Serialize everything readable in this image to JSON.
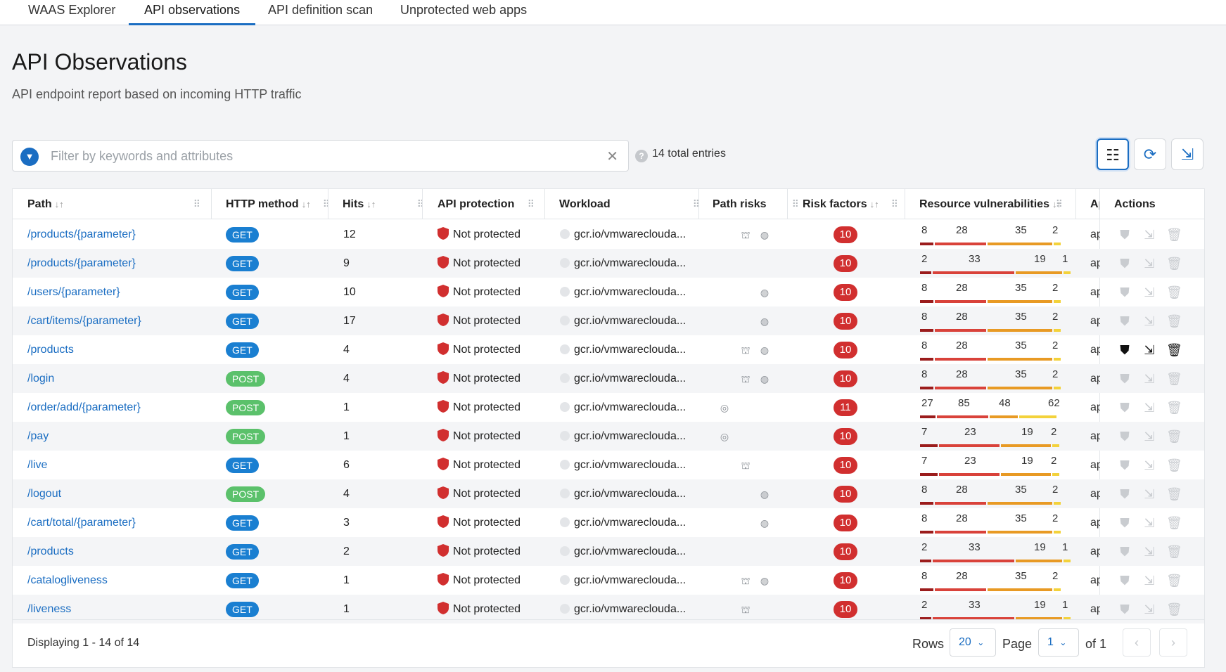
{
  "tabs": [
    "WAAS Explorer",
    "API observations",
    "API definition scan",
    "Unprotected web apps"
  ],
  "page": {
    "title": "API Observations",
    "subtitle": "API endpoint report based on incoming HTTP traffic"
  },
  "filter": {
    "placeholder": "Filter by keywords and attributes",
    "total": "14 total entries"
  },
  "columns": {
    "path": "Path",
    "method": "HTTP method",
    "hits": "Hits",
    "protection": "API protection",
    "workload": "Workload",
    "path_risks": "Path risks",
    "risk_factors": "Risk factors",
    "vulns": "Resource vulnerabilities",
    "app": "Ap",
    "actions": "Actions"
  },
  "rows": [
    {
      "path": "/products/{parameter}",
      "method": "GET",
      "hits": "12",
      "protection": "Not protected",
      "workload": "gcr.io/vmwareclouda...",
      "risks": [
        "door",
        "globe"
      ],
      "risk": "10",
      "vulns": [
        "8",
        "28",
        "35",
        "2"
      ],
      "app": "ap"
    },
    {
      "path": "/products/{parameter}",
      "method": "GET",
      "hits": "9",
      "protection": "Not protected",
      "workload": "gcr.io/vmwareclouda...",
      "risks": [],
      "risk": "10",
      "vulns": [
        "2",
        "33",
        "19",
        "1"
      ],
      "app": "ap"
    },
    {
      "path": "/users/{parameter}",
      "method": "GET",
      "hits": "10",
      "protection": "Not protected",
      "workload": "gcr.io/vmwareclouda...",
      "risks": [
        "globe"
      ],
      "risk": "10",
      "vulns": [
        "8",
        "28",
        "35",
        "2"
      ],
      "app": "ap"
    },
    {
      "path": "/cart/items/{parameter}",
      "method": "GET",
      "hits": "17",
      "protection": "Not protected",
      "workload": "gcr.io/vmwareclouda...",
      "risks": [
        "globe"
      ],
      "risk": "10",
      "vulns": [
        "8",
        "28",
        "35",
        "2"
      ],
      "app": "ap"
    },
    {
      "path": "/products",
      "method": "GET",
      "hits": "4",
      "protection": "Not protected",
      "workload": "gcr.io/vmwareclouda...",
      "risks": [
        "door",
        "globe"
      ],
      "risk": "10",
      "vulns": [
        "8",
        "28",
        "35",
        "2"
      ],
      "app": "ap"
    },
    {
      "path": "/login",
      "method": "POST",
      "hits": "4",
      "protection": "Not protected",
      "workload": "gcr.io/vmwareclouda...",
      "risks": [
        "door",
        "globe"
      ],
      "risk": "10",
      "vulns": [
        "8",
        "28",
        "35",
        "2"
      ],
      "app": "ap"
    },
    {
      "path": "/order/add/{parameter}",
      "method": "POST",
      "hits": "1",
      "protection": "Not protected",
      "workload": "gcr.io/vmwareclouda...",
      "risks": [
        "fingerprint"
      ],
      "risk": "11",
      "vulns": [
        "27",
        "85",
        "48",
        "62"
      ],
      "app": "ap"
    },
    {
      "path": "/pay",
      "method": "POST",
      "hits": "1",
      "protection": "Not protected",
      "workload": "gcr.io/vmwareclouda...",
      "risks": [
        "fingerprint"
      ],
      "risk": "10",
      "vulns": [
        "7",
        "23",
        "19",
        "2"
      ],
      "app": "ap"
    },
    {
      "path": "/live",
      "method": "GET",
      "hits": "6",
      "protection": "Not protected",
      "workload": "gcr.io/vmwareclouda...",
      "risks": [
        "door"
      ],
      "risk": "10",
      "vulns": [
        "7",
        "23",
        "19",
        "2"
      ],
      "app": "ap"
    },
    {
      "path": "/logout",
      "method": "POST",
      "hits": "4",
      "protection": "Not protected",
      "workload": "gcr.io/vmwareclouda...",
      "risks": [
        "globe"
      ],
      "risk": "10",
      "vulns": [
        "8",
        "28",
        "35",
        "2"
      ],
      "app": "ap"
    },
    {
      "path": "/cart/total/{parameter}",
      "method": "GET",
      "hits": "3",
      "protection": "Not protected",
      "workload": "gcr.io/vmwareclouda...",
      "risks": [
        "globe"
      ],
      "risk": "10",
      "vulns": [
        "8",
        "28",
        "35",
        "2"
      ],
      "app": "ap"
    },
    {
      "path": "/products",
      "method": "GET",
      "hits": "2",
      "protection": "Not protected",
      "workload": "gcr.io/vmwareclouda...",
      "risks": [],
      "risk": "10",
      "vulns": [
        "2",
        "33",
        "19",
        "1"
      ],
      "app": "ap"
    },
    {
      "path": "/catalogliveness",
      "method": "GET",
      "hits": "1",
      "protection": "Not protected",
      "workload": "gcr.io/vmwareclouda...",
      "risks": [
        "door",
        "globe"
      ],
      "risk": "10",
      "vulns": [
        "8",
        "28",
        "35",
        "2"
      ],
      "app": "ap"
    },
    {
      "path": "/liveness",
      "method": "GET",
      "hits": "1",
      "protection": "Not protected",
      "workload": "gcr.io/vmwareclouda...",
      "risks": [
        "door"
      ],
      "risk": "10",
      "vulns": [
        "2",
        "33",
        "19",
        "1"
      ],
      "app": "ap"
    }
  ],
  "footer": {
    "displaying": "Displaying 1 - 14 of 14",
    "rows_label": "Rows",
    "rows_value": "20",
    "page_label": "Page",
    "page_value": "1",
    "of_label": "of 1"
  },
  "colors": {
    "accent": "#1a6dc2",
    "get": "#1a7fd1",
    "post": "#5bc16b",
    "risk": "#d12f2f",
    "critical": "#9b1c1c",
    "high": "#d9423a",
    "medium": "#e89a24",
    "low": "#f3d23b"
  }
}
